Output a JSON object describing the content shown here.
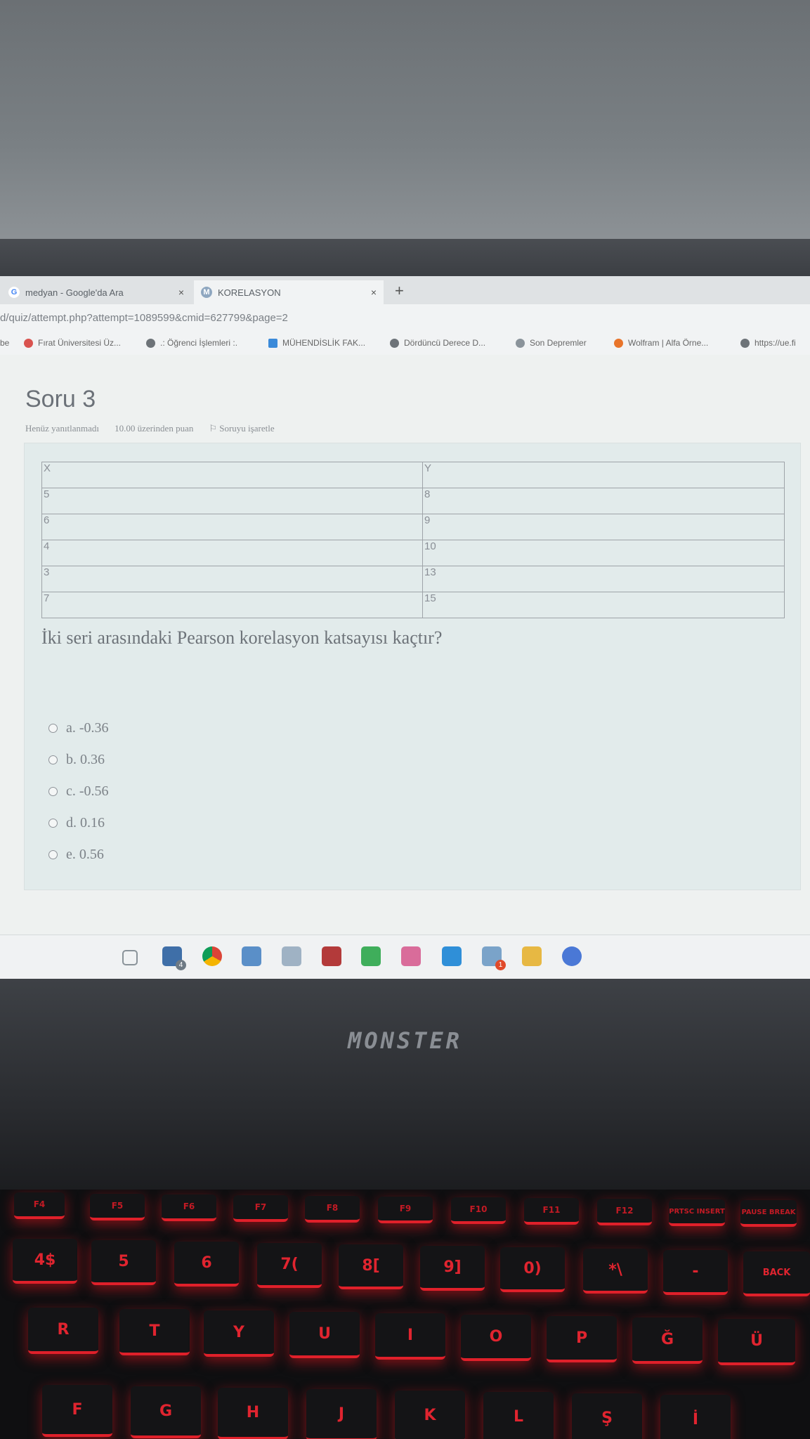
{
  "browser": {
    "tabs": [
      {
        "title": "medyan - Google'da Ara",
        "icon": "google-icon"
      },
      {
        "title": "KORELASYON",
        "icon": "moodle-icon"
      }
    ],
    "new_tab_symbol": "+",
    "close_symbol": "×",
    "url": "d/quiz/attempt.php?attempt=1089599&cmid=627799&page=2",
    "bookmarks": [
      {
        "label": "be",
        "icon": ""
      },
      {
        "label": "Fırat Üniversitesi Üz...",
        "icon": "university-icon"
      },
      {
        "label": ".: Öğrenci İşlemleri :.",
        "icon": "globe-icon"
      },
      {
        "label": "MÜHENDİSLİK FAK...",
        "icon": "drive-icon"
      },
      {
        "label": "Dördüncü Derece D...",
        "icon": "globe-icon"
      },
      {
        "label": "Son Depremler",
        "icon": "quake-icon"
      },
      {
        "label": "Wolfram | Alfa Örne...",
        "icon": "wolfram-icon"
      },
      {
        "label": "https://ue.fi",
        "icon": "globe-icon"
      }
    ]
  },
  "question": {
    "title": "Soru 3",
    "status": "Henüz yanıtlanmadı",
    "points": "10.00 üzerinden puan",
    "flag_label": "Soruyu işaretle",
    "table": {
      "headers": [
        "X",
        "Y"
      ],
      "rows": [
        [
          "5",
          "8"
        ],
        [
          "6",
          "9"
        ],
        [
          "4",
          "10"
        ],
        [
          "3",
          "13"
        ],
        [
          "7",
          "15"
        ]
      ]
    },
    "text": "İki seri arasındaki Pearson korelasyon katsayısı kaçtır?",
    "answers": [
      "a. -0.36",
      "b. 0.36",
      "c. -0.56",
      "d. 0.16",
      "e. 0.56"
    ]
  },
  "taskbar": {
    "mail_badge": "4",
    "store_badge": "1"
  },
  "laptop": {
    "brand": "MONSTER"
  },
  "keyboard": {
    "function_row": [
      "F4",
      "F5",
      "F6",
      "F7",
      "F8",
      "F9",
      "F10",
      "F11",
      "F12",
      "PRTSC INSERT",
      "PAUSE BREAK"
    ],
    "number_row": [
      "4$",
      "5",
      "6",
      "7(",
      "8[",
      "9]",
      "0)",
      "*\\",
      "-",
      "BACK"
    ],
    "letter_row": [
      "R",
      "T",
      "Y",
      "U",
      "I",
      "O",
      "P",
      "Ğ",
      "Ü"
    ],
    "home_row": [
      "F",
      "G",
      "H",
      "J",
      "K",
      "L",
      "Ş",
      "İ"
    ]
  }
}
